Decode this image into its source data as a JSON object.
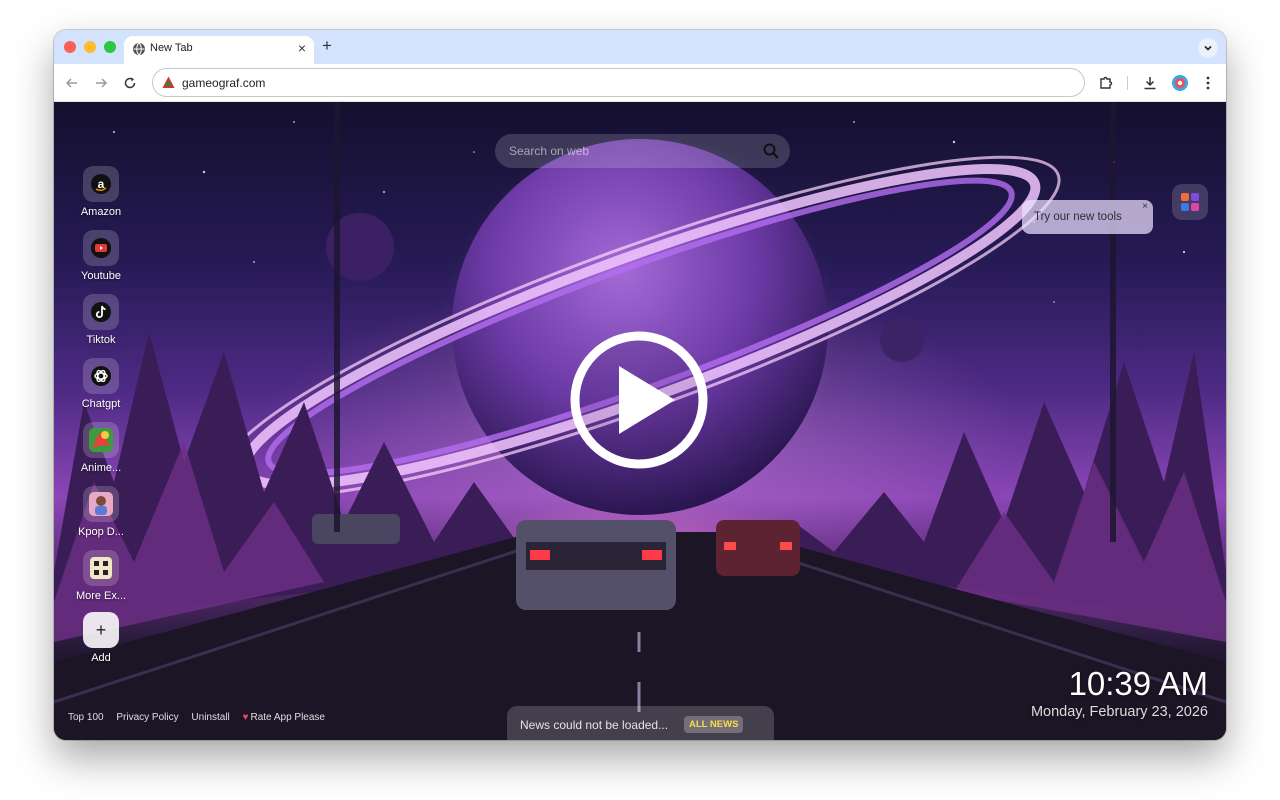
{
  "browser": {
    "tab_title": "New Tab",
    "new_tab_symbol": "+",
    "url": "gameograf.com"
  },
  "search": {
    "placeholder": "Search on web"
  },
  "shortcuts": [
    {
      "label": "Amazon",
      "icon": "amazon-icon"
    },
    {
      "label": "Youtube",
      "icon": "youtube-icon"
    },
    {
      "label": "Tiktok",
      "icon": "tiktok-icon"
    },
    {
      "label": "Chatgpt",
      "icon": "chatgpt-icon"
    },
    {
      "label": "Anime...",
      "icon": "anime-icon"
    },
    {
      "label": "Kpop D...",
      "icon": "kpop-icon"
    },
    {
      "label": "More Ex...",
      "icon": "more-extensions-icon"
    },
    {
      "label": "Add",
      "icon": "plus-icon"
    }
  ],
  "add_symbol": "+",
  "tools_promo": {
    "text": "Try our new tools",
    "close": "×"
  },
  "footer": {
    "links": [
      "Top 100",
      "Privacy Policy",
      "Uninstall",
      "Rate App Please"
    ]
  },
  "news": {
    "text": "News could not be loaded...",
    "badge": "ALL NEWS"
  },
  "clock": {
    "time": "10:39 AM",
    "date": "Monday, February 23, 2026"
  },
  "colors": {
    "tabstrip": "#d3e3fd",
    "accent": "#ffd84a"
  }
}
